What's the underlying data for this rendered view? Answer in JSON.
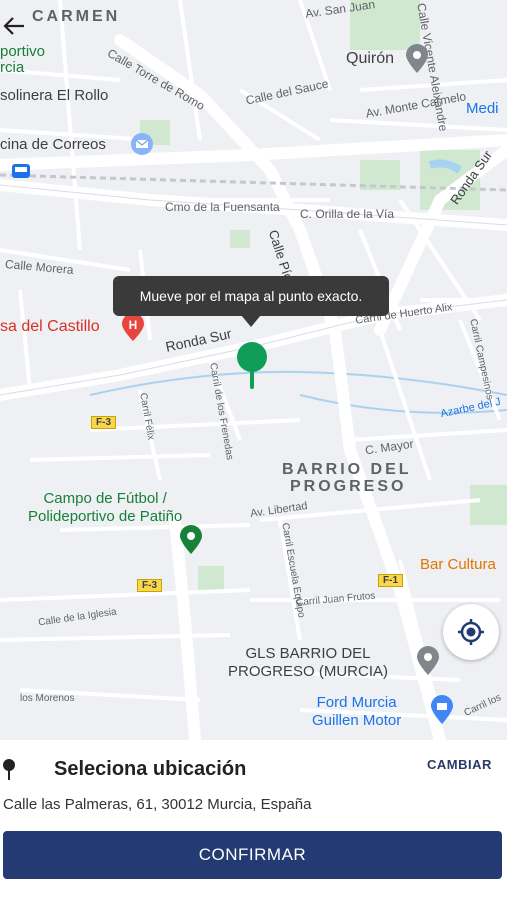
{
  "map": {
    "areas": {
      "carmen": "CARMEN",
      "barrio_line1": "BARRIO DEL",
      "barrio_line2": "PROGRESO"
    },
    "streets": {
      "torre_romo": "Calle Torre de Romo",
      "ronda_sur_w": "Ronda Sur",
      "ronda_sur_e": "Ronda Sur",
      "sauce": "Calle del Sauce",
      "monte_carmelo": "Av. Monte Carmelo",
      "san_juan": "Av. San Juan",
      "vicente": "Calle Vicente Aleixandre",
      "fuensanta": "Cmo de la Fuensanta",
      "orilla_via": "C. Orilla de la Vía",
      "pio": "Calle Pío XII",
      "morera": "Calle Morera",
      "huerto_alix": "Carril de Huerto Alix",
      "campesinos": "Carril Campesinos",
      "frenedas": "Carril de los Frenedas",
      "felix": "Carril Félix",
      "azarbe": "Azarbe del J",
      "c_mayor": "C. Mayor",
      "libertad": "Av. Libertad",
      "escuela": "Carril Escuela Equipo",
      "juan_frutos": "Carril Juan Frutos",
      "iglesia": "Calle de la Iglesia",
      "morenos": "los Morenos",
      "carril_los": "Carril los"
    },
    "pois": {
      "deportivo_l1": "portivo",
      "deportivo_l2": "rcia",
      "gasolinera": "solinera El Rollo",
      "correos": "cina de Correos",
      "quiron": "Quirón",
      "medi": "Medi",
      "castillo": "sa del Castillo",
      "campo_l1": "Campo de Fútbol /",
      "campo_l2": "Polideportivo de Patiño",
      "bar": "Bar Cultura",
      "gls_l1": "GLS BARRIO DEL",
      "gls_l2": "PROGRESO (MURCIA)",
      "ford_l1": "Ford Murcia",
      "ford_l2": "Guillen Motor"
    },
    "shields": {
      "f3a": "F-3",
      "f3b": "F-3",
      "f1": "F-1"
    },
    "tooltip": "Mueve por el mapa al punto exacto.",
    "colors": {
      "pin": "#0f9d58",
      "road_major": "#ffffff",
      "background": "#eef0f3",
      "water": "#a8d3f0",
      "park": "#c8e6c9"
    }
  },
  "panel": {
    "title": "Seleciona ubicación",
    "change_label": "CAMBIAR",
    "address": "Calle las Palmeras, 61, 30012 Murcia, España",
    "confirm_label": "CONFIRMAR"
  }
}
